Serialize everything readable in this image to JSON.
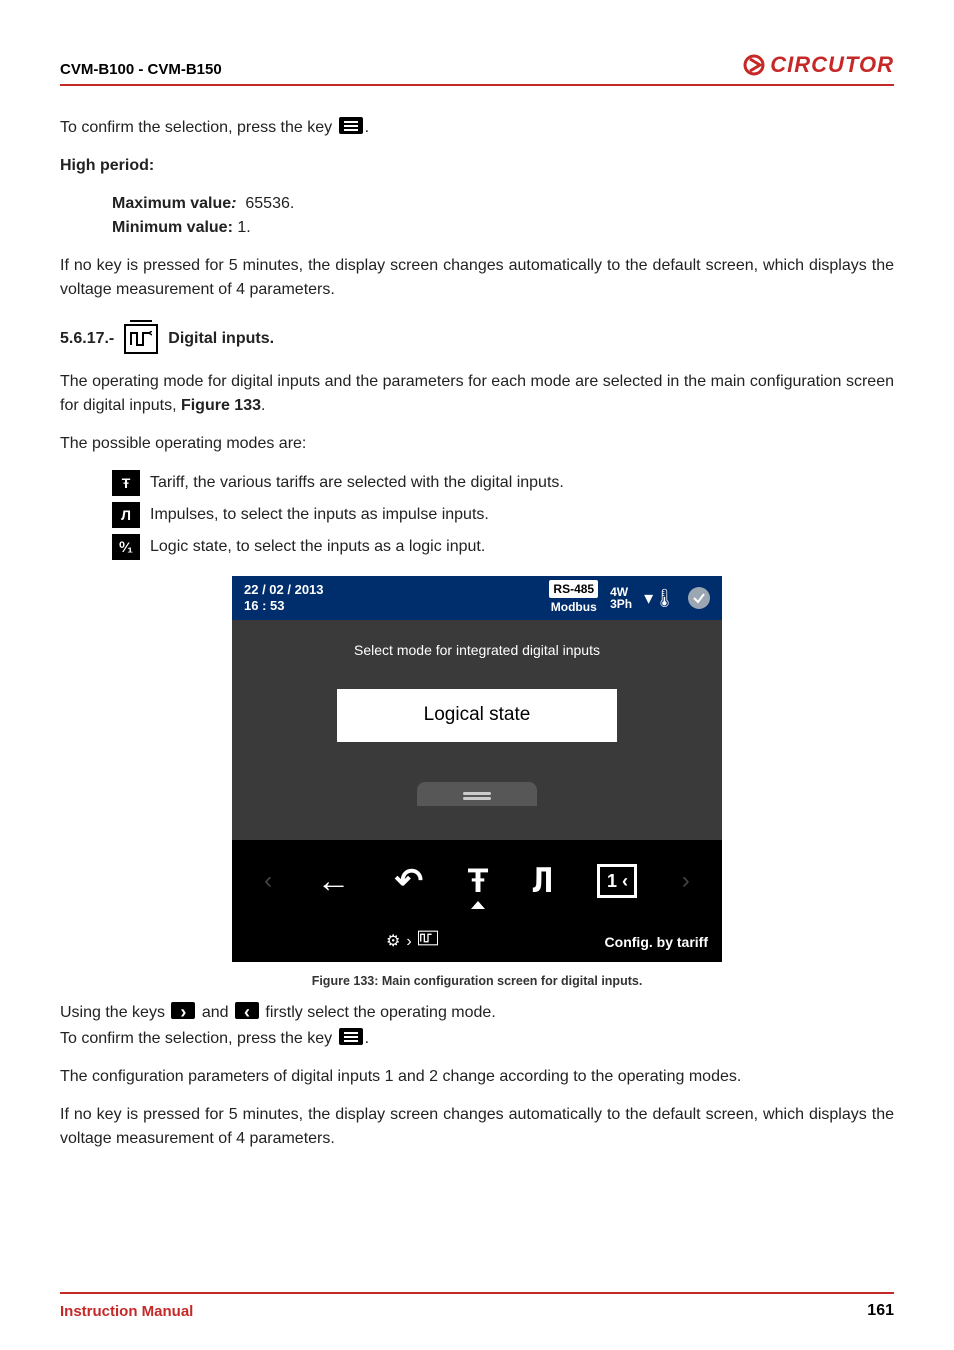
{
  "header": {
    "left": "CVM-B100 - CVM-B150",
    "logo": "CIRCUTOR"
  },
  "p1": {
    "a": "To confirm the selection, press the key ",
    "b": "."
  },
  "p2": "High period:",
  "p3": {
    "label1": "Maximum value",
    "val1": "65536.",
    "label2": "Minimum value:",
    "val2": "1."
  },
  "p4": "If no key is pressed for 5 minutes, the display screen changes automatically to the default screen, which displays the voltage measurement of 4 parameters.",
  "section": {
    "num": "5.6.17.-",
    "title": "Digital inputs."
  },
  "p5": {
    "a": "The operating mode for digital inputs and the parameters for each mode are selected in the main configuration screen for digital inputs, ",
    "fig": "Figure 133",
    "b": "."
  },
  "p6": "The possible operating modes are:",
  "modes": {
    "tariff": {
      "glyph": "Ŧ",
      "text": "Tariff, the various tariffs are selected with the digital inputs."
    },
    "impulse": {
      "glyph": "Л",
      "text": "Impulses, to select the inputs as impulse inputs."
    },
    "logic": {
      "glyph": "⁰⁄₁",
      "text": "Logic state, to select the inputs as a logic input."
    }
  },
  "device": {
    "datetime_date": "22 / 02 / 2013",
    "datetime_time": "16 : 53",
    "rs": "RS-485",
    "modbus": "Modbus",
    "wire1": "4W",
    "wire2": "3Ph",
    "message": "Select mode for integrated digital inputs",
    "selection": "Logical state",
    "logic_box": "1 ‹",
    "bottom_right": "Config. by tariff"
  },
  "caption": "Figure 133: Main configuration screen for digital inputs.",
  "p7": {
    "a": "Using the keys ",
    "b": " and ",
    "c": " firstly select the operating mode."
  },
  "p8": {
    "a": "To confirm the selection, press the key ",
    "b": "."
  },
  "p9": "The configuration parameters of digital inputs 1 and 2 change according to the operating modes.",
  "p10": "If no key is pressed for 5 minutes, the display screen changes automatically to the default screen, which displays the voltage measurement of 4 parameters.",
  "footer": {
    "left": "Instruction Manual",
    "page": "161"
  },
  "chart_data": {
    "type": "table",
    "description": "Figure 133 depicts a device UI screen (not a quantitative chart); textual contents captured under 'device' key."
  }
}
